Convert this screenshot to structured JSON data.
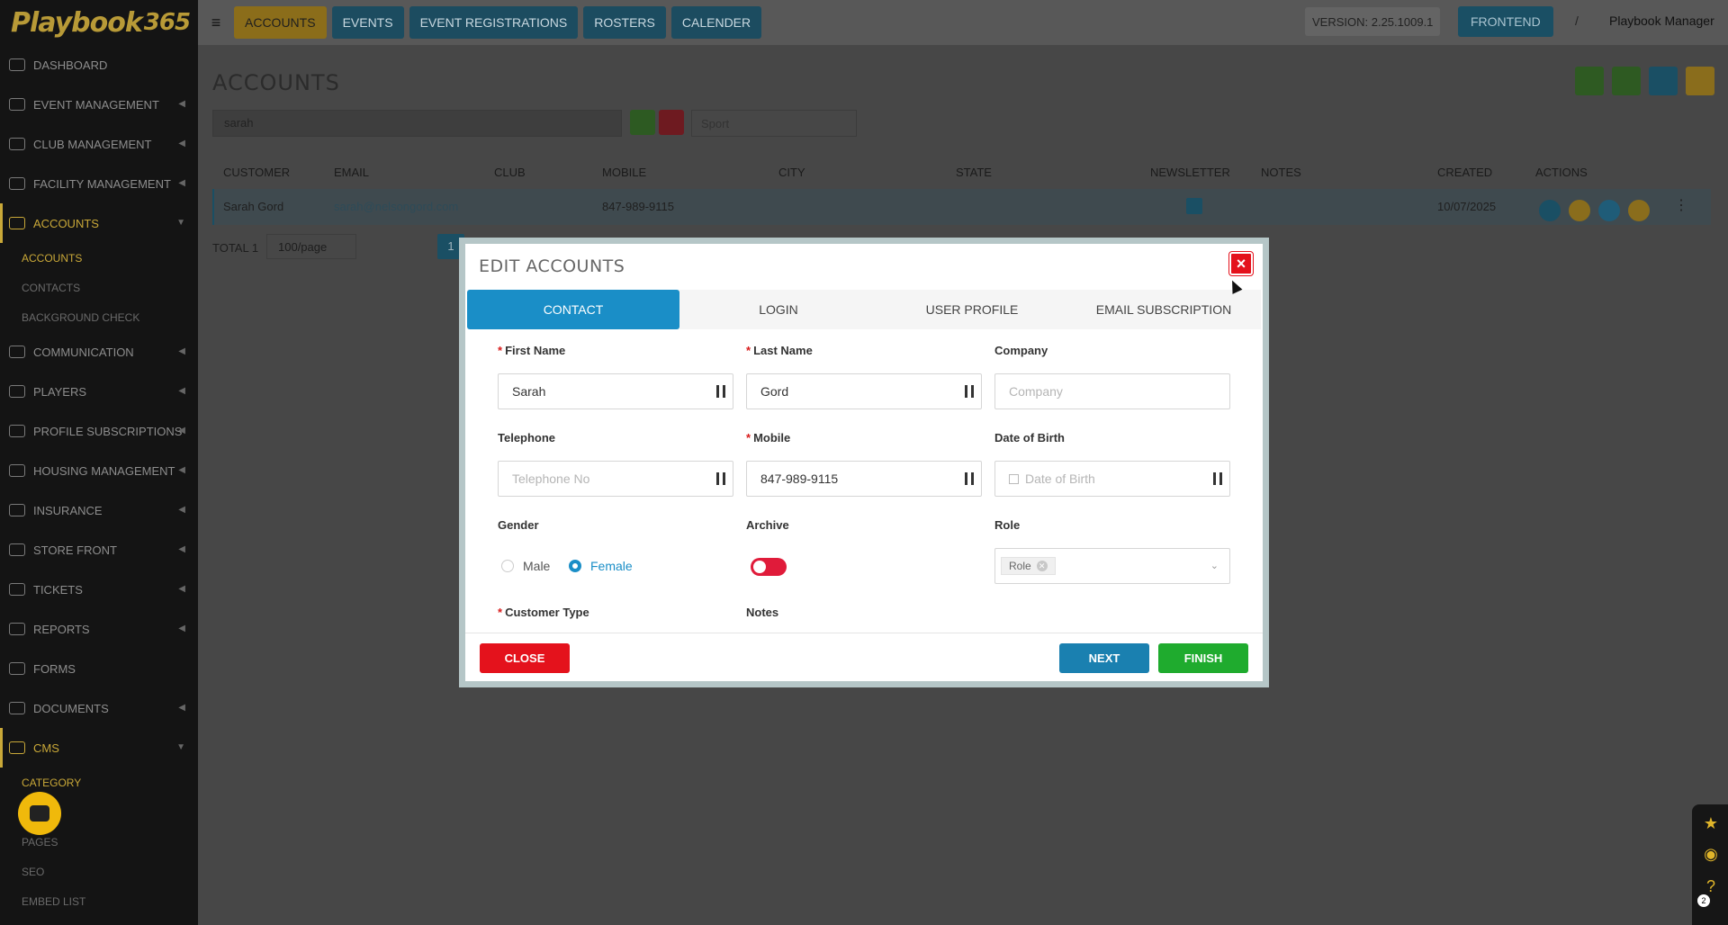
{
  "app": {
    "logo": "Playbook",
    "logo_suffix": "365",
    "version": "VERSION: 2.25.1009.1",
    "frontend_label": "FRONTEND",
    "separator": "/",
    "user_name": "Playbook Manager"
  },
  "topnav": [
    {
      "label": "ACCOUNTS"
    },
    {
      "label": "EVENTS"
    },
    {
      "label": "EVENT REGISTRATIONS"
    },
    {
      "label": "ROSTERS"
    },
    {
      "label": "CALENDER"
    }
  ],
  "sidebar": {
    "items": [
      {
        "label": "DASHBOARD"
      },
      {
        "label": "EVENT MANAGEMENT"
      },
      {
        "label": "CLUB MANAGEMENT"
      },
      {
        "label": "FACILITY MANAGEMENT"
      },
      {
        "label": "ACCOUNTS"
      },
      {
        "label": "COMMUNICATION"
      },
      {
        "label": "PLAYERS"
      },
      {
        "label": "PROFILE SUBSCRIPTIONS"
      },
      {
        "label": "HOUSING MANAGEMENT"
      },
      {
        "label": "INSURANCE"
      },
      {
        "label": "STORE FRONT"
      },
      {
        "label": "TICKETS"
      },
      {
        "label": "REPORTS"
      },
      {
        "label": "FORMS"
      },
      {
        "label": "DOCUMENTS"
      },
      {
        "label": "CMS"
      }
    ],
    "accounts_sub": [
      {
        "label": "ACCOUNTS"
      },
      {
        "label": "CONTACTS"
      },
      {
        "label": "BACKGROUND CHECK"
      }
    ],
    "cms_sub": [
      {
        "label": "CATEGORY"
      },
      {
        "label": "PAGES"
      },
      {
        "label": "SEO"
      },
      {
        "label": "EMBED LIST"
      }
    ]
  },
  "page": {
    "title": "ACCOUNTS",
    "search_value": "sarah",
    "sport_placeholder": "Sport",
    "columns": [
      "CUSTOMER",
      "EMAIL",
      "CLUB",
      "MOBILE",
      "CITY",
      "STATE",
      "NEWSLETTER",
      "NOTES",
      "CREATED",
      "ACTIONS"
    ],
    "row": {
      "customer": "Sarah Gord",
      "email": "sarah@nelsongord.com",
      "club": "",
      "mobile": "847-989-9115",
      "city": "",
      "state": "",
      "newsletter": true,
      "notes": "",
      "created": "10/07/2025"
    },
    "total_label": "TOTAL 1",
    "per_page": "100/page",
    "current_page": "1"
  },
  "modal": {
    "title": "EDIT ACCOUNTS",
    "close_x": "×",
    "tabs": [
      "CONTACT",
      "LOGIN",
      "USER PROFILE",
      "EMAIL SUBSCRIPTION"
    ],
    "fields": {
      "first_name_label": "First Name",
      "first_name_value": "Sarah",
      "last_name_label": "Last Name",
      "last_name_value": "Gord",
      "company_label": "Company",
      "company_placeholder": "Company",
      "telephone_label": "Telephone",
      "telephone_placeholder": "Telephone No",
      "mobile_label": "Mobile",
      "mobile_value": "847-989-9115",
      "dob_label": "Date of Birth",
      "dob_placeholder": "Date of Birth",
      "gender_label": "Gender",
      "gender_male": "Male",
      "gender_female": "Female",
      "archive_label": "Archive",
      "role_label": "Role",
      "role_chip": "Role",
      "customer_type_label": "Customer Type",
      "notes_label": "Notes"
    },
    "buttons": {
      "close": "CLOSE",
      "next": "NEXT",
      "finish": "FINISH"
    }
  },
  "floating": {
    "badge": "2"
  },
  "colors": {
    "primary": "#1a8ec7",
    "danger": "#e4121c",
    "success": "#1fab2e",
    "gold": "#c9a838"
  }
}
